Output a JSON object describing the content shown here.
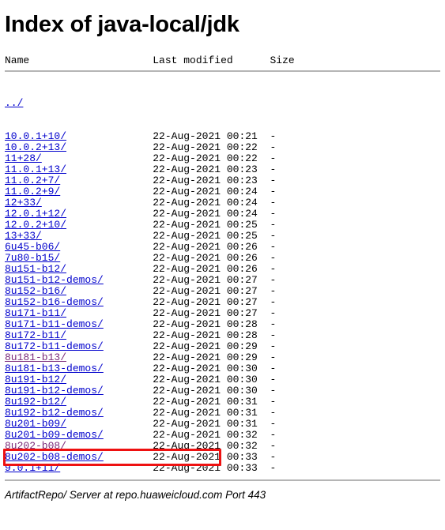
{
  "page": {
    "title": "Index of java-local/jdk",
    "columns": {
      "name": "Name",
      "last_modified": "Last modified",
      "size": "Size"
    },
    "header_line": "Name                    Last modified      Size",
    "parent_link": "../",
    "footer": "ArtifactRepo/ Server at repo.huaweicloud.com Port 443"
  },
  "colors": {
    "link": "#0000cc",
    "visited_link": "#7a2a7a",
    "highlight_border": "#ee1111",
    "rule": "#b5b5b5",
    "text": "#000000",
    "background": "#ffffff"
  },
  "highlight": {
    "target_row_index": 30,
    "target_name": "8u202-b08/"
  },
  "entries": [
    {
      "name": "10.0.1+10/",
      "last_modified": "22-Aug-2021 00:21",
      "size": "-",
      "visited": false
    },
    {
      "name": "10.0.2+13/",
      "last_modified": "22-Aug-2021 00:22",
      "size": "-",
      "visited": false
    },
    {
      "name": "11+28/",
      "last_modified": "22-Aug-2021 00:22",
      "size": "-",
      "visited": false
    },
    {
      "name": "11.0.1+13/",
      "last_modified": "22-Aug-2021 00:23",
      "size": "-",
      "visited": false
    },
    {
      "name": "11.0.2+7/",
      "last_modified": "22-Aug-2021 00:23",
      "size": "-",
      "visited": false
    },
    {
      "name": "11.0.2+9/",
      "last_modified": "22-Aug-2021 00:24",
      "size": "-",
      "visited": false
    },
    {
      "name": "12+33/",
      "last_modified": "22-Aug-2021 00:24",
      "size": "-",
      "visited": false
    },
    {
      "name": "12.0.1+12/",
      "last_modified": "22-Aug-2021 00:24",
      "size": "-",
      "visited": false
    },
    {
      "name": "12.0.2+10/",
      "last_modified": "22-Aug-2021 00:25",
      "size": "-",
      "visited": false
    },
    {
      "name": "13+33/",
      "last_modified": "22-Aug-2021 00:25",
      "size": "-",
      "visited": false
    },
    {
      "name": "6u45-b06/",
      "last_modified": "22-Aug-2021 00:26",
      "size": "-",
      "visited": false
    },
    {
      "name": "7u80-b15/",
      "last_modified": "22-Aug-2021 00:26",
      "size": "-",
      "visited": false
    },
    {
      "name": "8u151-b12/",
      "last_modified": "22-Aug-2021 00:26",
      "size": "-",
      "visited": false
    },
    {
      "name": "8u151-b12-demos/",
      "last_modified": "22-Aug-2021 00:27",
      "size": "-",
      "visited": false
    },
    {
      "name": "8u152-b16/",
      "last_modified": "22-Aug-2021 00:27",
      "size": "-",
      "visited": false
    },
    {
      "name": "8u152-b16-demos/",
      "last_modified": "22-Aug-2021 00:27",
      "size": "-",
      "visited": false
    },
    {
      "name": "8u171-b11/",
      "last_modified": "22-Aug-2021 00:27",
      "size": "-",
      "visited": false
    },
    {
      "name": "8u171-b11-demos/",
      "last_modified": "22-Aug-2021 00:28",
      "size": "-",
      "visited": false
    },
    {
      "name": "8u172-b11/",
      "last_modified": "22-Aug-2021 00:28",
      "size": "-",
      "visited": false
    },
    {
      "name": "8u172-b11-demos/",
      "last_modified": "22-Aug-2021 00:29",
      "size": "-",
      "visited": false
    },
    {
      "name": "8u181-b13/",
      "last_modified": "22-Aug-2021 00:29",
      "size": "-",
      "visited": true
    },
    {
      "name": "8u181-b13-demos/",
      "last_modified": "22-Aug-2021 00:30",
      "size": "-",
      "visited": false
    },
    {
      "name": "8u191-b12/",
      "last_modified": "22-Aug-2021 00:30",
      "size": "-",
      "visited": false
    },
    {
      "name": "8u191-b12-demos/",
      "last_modified": "22-Aug-2021 00:30",
      "size": "-",
      "visited": false
    },
    {
      "name": "8u192-b12/",
      "last_modified": "22-Aug-2021 00:31",
      "size": "-",
      "visited": false
    },
    {
      "name": "8u192-b12-demos/",
      "last_modified": "22-Aug-2021 00:31",
      "size": "-",
      "visited": false
    },
    {
      "name": "8u201-b09/",
      "last_modified": "22-Aug-2021 00:31",
      "size": "-",
      "visited": false
    },
    {
      "name": "8u201-b09-demos/",
      "last_modified": "22-Aug-2021 00:32",
      "size": "-",
      "visited": false
    },
    {
      "name": "8u202-b08/",
      "last_modified": "22-Aug-2021 00:32",
      "size": "-",
      "visited": true
    },
    {
      "name": "8u202-b08-demos/",
      "last_modified": "22-Aug-2021 00:33",
      "size": "-",
      "visited": false
    },
    {
      "name": "9.0.1+11/",
      "last_modified": "22-Aug-2021 00:33",
      "size": "-",
      "visited": false
    }
  ]
}
